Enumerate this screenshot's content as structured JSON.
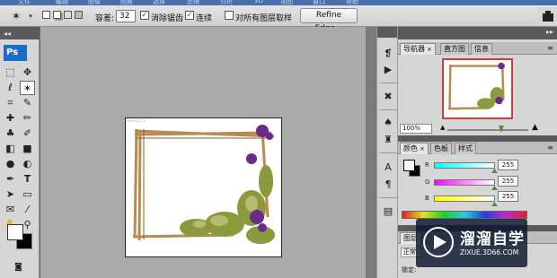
{
  "menu_bar": {
    "items": [
      "文件",
      "编辑",
      "图像",
      "图层",
      "选择",
      "滤镜",
      "分析",
      "3D",
      "视图",
      "窗口",
      "帮助"
    ]
  },
  "options_bar": {
    "tolerance_label": "容差:",
    "tolerance_value": "32",
    "anti_alias_label": "消除锯齿",
    "anti_alias_checked": true,
    "contiguous_label": "连续",
    "contiguous_checked": true,
    "sample_all_label": "对所有图层取样",
    "sample_all_checked": false,
    "refine_edge_label": "Refine Edge..."
  },
  "toolbox": {
    "logo": "Ps",
    "active_tool": "magic-wand"
  },
  "document": {
    "caption": "www.ps.cn"
  },
  "navigator_panel": {
    "tabs": [
      "导航器",
      "直方图",
      "信息"
    ],
    "active_tab": "导航器",
    "zoom": "100%"
  },
  "color_panel": {
    "tabs": [
      "颜色",
      "色板",
      "样式"
    ],
    "active_tab": "颜色",
    "channels": [
      {
        "label": "R",
        "value": "255"
      },
      {
        "label": "G",
        "value": "255"
      },
      {
        "label": "B",
        "value": "255"
      }
    ]
  },
  "layers_panel": {
    "tab_label": "图层",
    "blend_mode": "正常",
    "lock_label": "锁定:"
  },
  "watermark": {
    "title": "溜溜自学",
    "subtitle": "ZIXUE.3D66.COM"
  },
  "colors": {
    "accent_blue": "#1a6dc7",
    "navigator_frame": "#d43a3a",
    "slider_green": "#4e8f3c"
  }
}
